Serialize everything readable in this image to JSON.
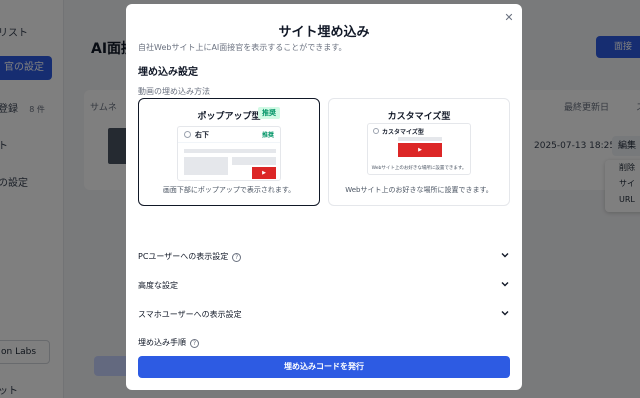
{
  "background": {
    "sidebar": {
      "items": [
        "リスト",
        "官の設定",
        "登録",
        "ト",
        "の設定"
      ],
      "item_count_badge": "8 件",
      "org_selector": "on Labs",
      "footer": "ット"
    },
    "page_title": "AI面接",
    "header_button": "面接",
    "table": {
      "columns": [
        "サムネ",
        "最終更新日",
        "ス"
      ],
      "row": {
        "date": "2025-07-13 18:25",
        "edit_button": "編集"
      },
      "row_menu": [
        "削除",
        "サイ",
        "URL"
      ]
    }
  },
  "modal": {
    "title": "サイト埋め込み",
    "description": "自社Webサイト上にAI面接官を表示することができます。",
    "section_title": "埋め込み設定",
    "method_label": "動画の埋め込み方法",
    "options": [
      {
        "title": "ポップアップ型",
        "badge": "推奨",
        "preview_position": "右下",
        "preview_tag": "推奨",
        "caption": "画面下部にポップアップで表示されます。",
        "selected": true
      },
      {
        "title": "カスタマイズ型",
        "preview_position": "カスタマイズ型",
        "preview_caption": "Webサイト上のお好きな場所に設置できます。",
        "caption": "Webサイト上のお好きな場所に設置できます。",
        "selected": false
      }
    ],
    "accordions": [
      {
        "label": "PCユーザーへの表示設定",
        "help": true
      },
      {
        "label": "高度な設定",
        "help": false
      },
      {
        "label": "スマホユーザーへの表示設定",
        "help": false
      }
    ],
    "embed_steps_label": "埋め込み手順",
    "submit_label": "埋め込みコードを発行",
    "colors": {
      "primary": "#2d5be3",
      "badge_bg": "#d1fae5",
      "badge_text": "#059669",
      "video": "#dc2626"
    },
    "icons": {
      "close": "close-icon",
      "help": "help-circle-icon",
      "chevron": "chevron-down-icon",
      "play": "play-icon"
    }
  }
}
